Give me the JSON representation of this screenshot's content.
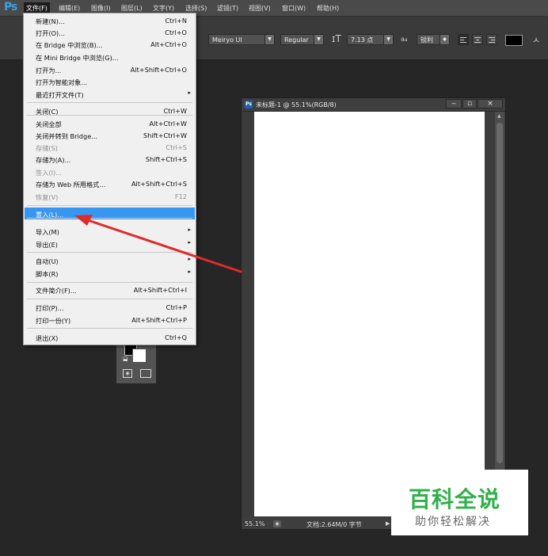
{
  "app": {
    "logo": "Ps"
  },
  "menubar": {
    "items": [
      "文件(F)",
      "编辑(E)",
      "图像(I)",
      "图层(L)",
      "文字(Y)",
      "选择(S)",
      "滤镜(T)",
      "视图(V)",
      "窗口(W)",
      "帮助(H)"
    ]
  },
  "options": {
    "font_family": "Meiryo UI",
    "font_style": "Regular",
    "font_size_icon": "font-size-icon",
    "font_size": "7.13 点",
    "aa_label": "a",
    "anti_alias": "锐利",
    "text_color": "#000000"
  },
  "file_menu": {
    "items": [
      {
        "label": "新建(N)...",
        "shortcut": "Ctrl+N"
      },
      {
        "label": "打开(O)...",
        "shortcut": "Ctrl+O"
      },
      {
        "label": "在 Bridge 中浏览(B)...",
        "shortcut": "Alt+Ctrl+O"
      },
      {
        "label": "在 Mini Bridge 中浏览(G)...",
        "shortcut": ""
      },
      {
        "label": "打开为...",
        "shortcut": "Alt+Shift+Ctrl+O"
      },
      {
        "label": "打开为智能对象...",
        "shortcut": ""
      },
      {
        "label": "最近打开文件(T)",
        "shortcut": ""
      },
      {
        "label": "关闭(C)",
        "shortcut": "Ctrl+W"
      },
      {
        "label": "关闭全部",
        "shortcut": "Alt+Ctrl+W"
      },
      {
        "label": "关闭并转到 Bridge...",
        "shortcut": "Shift+Ctrl+W"
      },
      {
        "label": "存储(S)",
        "shortcut": "Ctrl+S"
      },
      {
        "label": "存储为(A)...",
        "shortcut": "Shift+Ctrl+S"
      },
      {
        "label": "签入(I)...",
        "shortcut": ""
      },
      {
        "label": "存储为 Web 所用格式...",
        "shortcut": "Alt+Shift+Ctrl+S"
      },
      {
        "label": "恢复(V)",
        "shortcut": "F12"
      },
      {
        "label": "置入(L)...",
        "shortcut": ""
      },
      {
        "label": "导入(M)",
        "shortcut": ""
      },
      {
        "label": "导出(E)",
        "shortcut": ""
      },
      {
        "label": "自动(U)",
        "shortcut": ""
      },
      {
        "label": "脚本(R)",
        "shortcut": ""
      },
      {
        "label": "文件简介(F)...",
        "shortcut": "Alt+Shift+Ctrl+I"
      },
      {
        "label": "打印(P)...",
        "shortcut": "Ctrl+P"
      },
      {
        "label": "打印一份(Y)",
        "shortcut": "Alt+Shift+Ctrl+P"
      },
      {
        "label": "退出(X)",
        "shortcut": "Ctrl+Q"
      }
    ],
    "disabled": [
      "存储(S)",
      "签入(I)...",
      "恢复(V)"
    ],
    "highlighted": "置入(L)...",
    "submenu_marker": "▸"
  },
  "document": {
    "title": "未标题-1 @ 55.1%(RGB/8)",
    "zoom": "55.1%",
    "doc_info": "文档:2.64M/0 字节",
    "btn_minimize": "‒",
    "btn_maximize": "▫",
    "btn_close": "×"
  },
  "colors": {
    "menu_highlight": "#3797f0",
    "annotation_arrow": "#e02b2b",
    "watermark_green": "#2fb14a"
  },
  "watermark": {
    "main": "百科全说",
    "sub": "助你轻松解决"
  }
}
